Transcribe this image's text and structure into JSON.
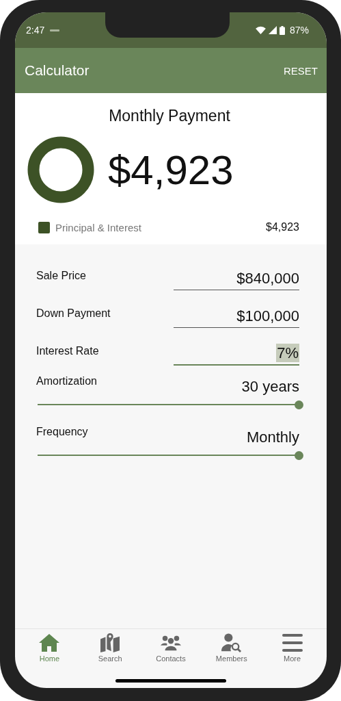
{
  "status_bar": {
    "time": "2:47",
    "battery": "87%"
  },
  "app_bar": {
    "title": "Calculator",
    "action": "RESET"
  },
  "summary": {
    "title": "Monthly Payment",
    "amount": "$4,923",
    "legend": [
      {
        "label": "Principal & Interest",
        "value": "$4,923",
        "color": "#3d5226"
      }
    ]
  },
  "fields": [
    {
      "kind": "input",
      "label": "Sale Price",
      "value": "$840,000",
      "focused": false
    },
    {
      "kind": "input",
      "label": "Down Payment",
      "value": "$100,000",
      "focused": false
    },
    {
      "kind": "input",
      "label": "Interest Rate",
      "value": "7%",
      "focused": true
    },
    {
      "kind": "slider",
      "label": "Amortization",
      "value": "30 years",
      "level": 1
    },
    {
      "kind": "slider",
      "label": "Frequency",
      "value": "Monthly",
      "level": 1
    }
  ],
  "nav": [
    {
      "label": "Home",
      "selected": true
    },
    {
      "label": "Search",
      "selected": false
    },
    {
      "label": "Contacts",
      "selected": false
    },
    {
      "label": "Members",
      "selected": false
    },
    {
      "label": "More",
      "selected": false
    }
  ]
}
